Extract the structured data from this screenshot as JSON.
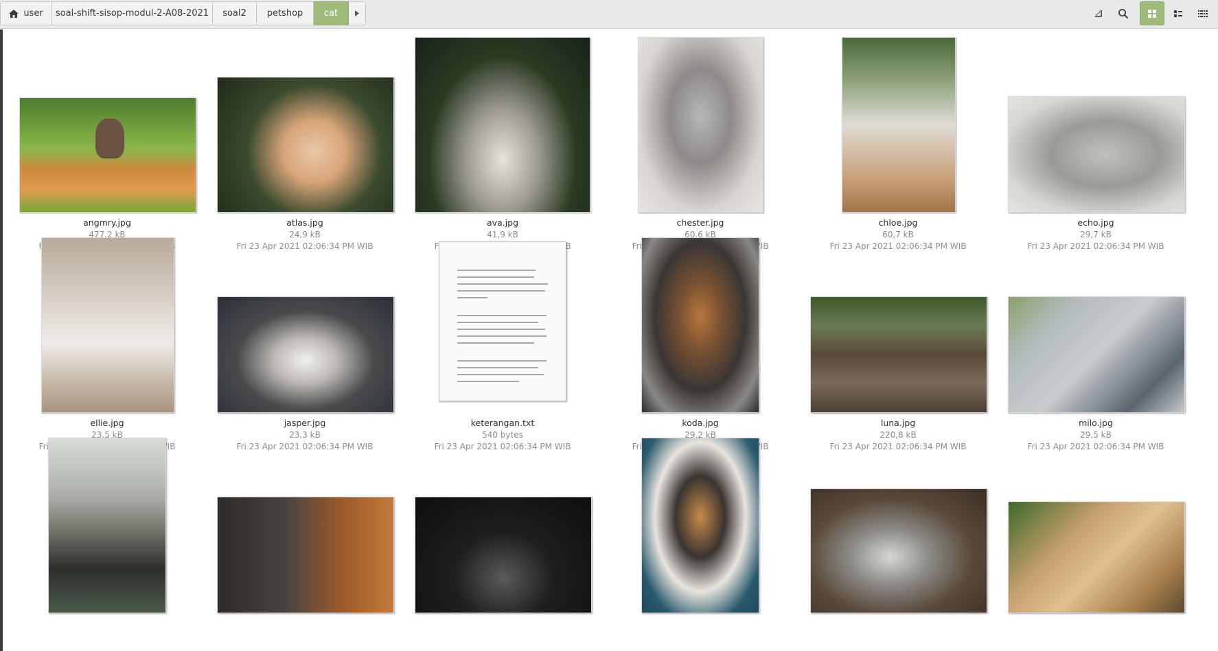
{
  "breadcrumb": [
    {
      "label": "user",
      "icon": "home-icon"
    },
    {
      "label": "soal-shift-sisop-modul-2-A08-2021"
    },
    {
      "label": "soal2"
    },
    {
      "label": "petshop"
    },
    {
      "label": "cat",
      "active": true
    }
  ],
  "toolbar": {
    "buttons": [
      "location-icon",
      "search-icon",
      "grid-view-icon",
      "list-view-icon",
      "compact-view-icon"
    ],
    "active_view": "grid-view-icon",
    "accent": "#9fbb7a"
  },
  "files": [
    {
      "name": "angmry.jpg",
      "size": "477,2 kB",
      "date": "Fri 23 Apr 2021 02:06:34 PM WIB"
    },
    {
      "name": "atlas.jpg",
      "size": "24,9 kB",
      "date": "Fri 23 Apr 2021 02:06:34 PM WIB"
    },
    {
      "name": "ava.jpg",
      "size": "41,9 kB",
      "date": "Fri 23 Apr 2021 02:06:34 PM WIB"
    },
    {
      "name": "chester.jpg",
      "size": "60,6 kB",
      "date": "Fri 23 Apr 2021 02:06:34 PM WIB"
    },
    {
      "name": "chloe.jpg",
      "size": "60,7 kB",
      "date": "Fri 23 Apr 2021 02:06:34 PM WIB"
    },
    {
      "name": "echo.jpg",
      "size": "29,7 kB",
      "date": "Fri 23 Apr 2021 02:06:34 PM WIB"
    },
    {
      "name": "ellie.jpg",
      "size": "23,5 kB",
      "date": "Fri 23 Apr 2021 02:06:34 PM WIB"
    },
    {
      "name": "jasper.jpg",
      "size": "23,3 kB",
      "date": "Fri 23 Apr 2021 02:06:34 PM WIB"
    },
    {
      "name": "keterangan.txt",
      "size": "540 bytes",
      "date": "Fri 23 Apr 2021 02:06:34 PM WIB"
    },
    {
      "name": "koda.jpg",
      "size": "29,2 kB",
      "date": "Fri 23 Apr 2021 02:06:34 PM WIB"
    },
    {
      "name": "luna.jpg",
      "size": "220,8 kB",
      "date": "Fri 23 Apr 2021 02:06:34 PM WIB"
    },
    {
      "name": "milo.jpg",
      "size": "29,5 kB",
      "date": "Fri 23 Apr 2021 02:06:34 PM WIB"
    },
    {
      "name": "",
      "size": "",
      "date": ""
    },
    {
      "name": "",
      "size": "",
      "date": ""
    },
    {
      "name": "",
      "size": "",
      "date": ""
    },
    {
      "name": "",
      "size": "",
      "date": ""
    },
    {
      "name": "",
      "size": "",
      "date": ""
    },
    {
      "name": "",
      "size": "",
      "date": ""
    }
  ]
}
